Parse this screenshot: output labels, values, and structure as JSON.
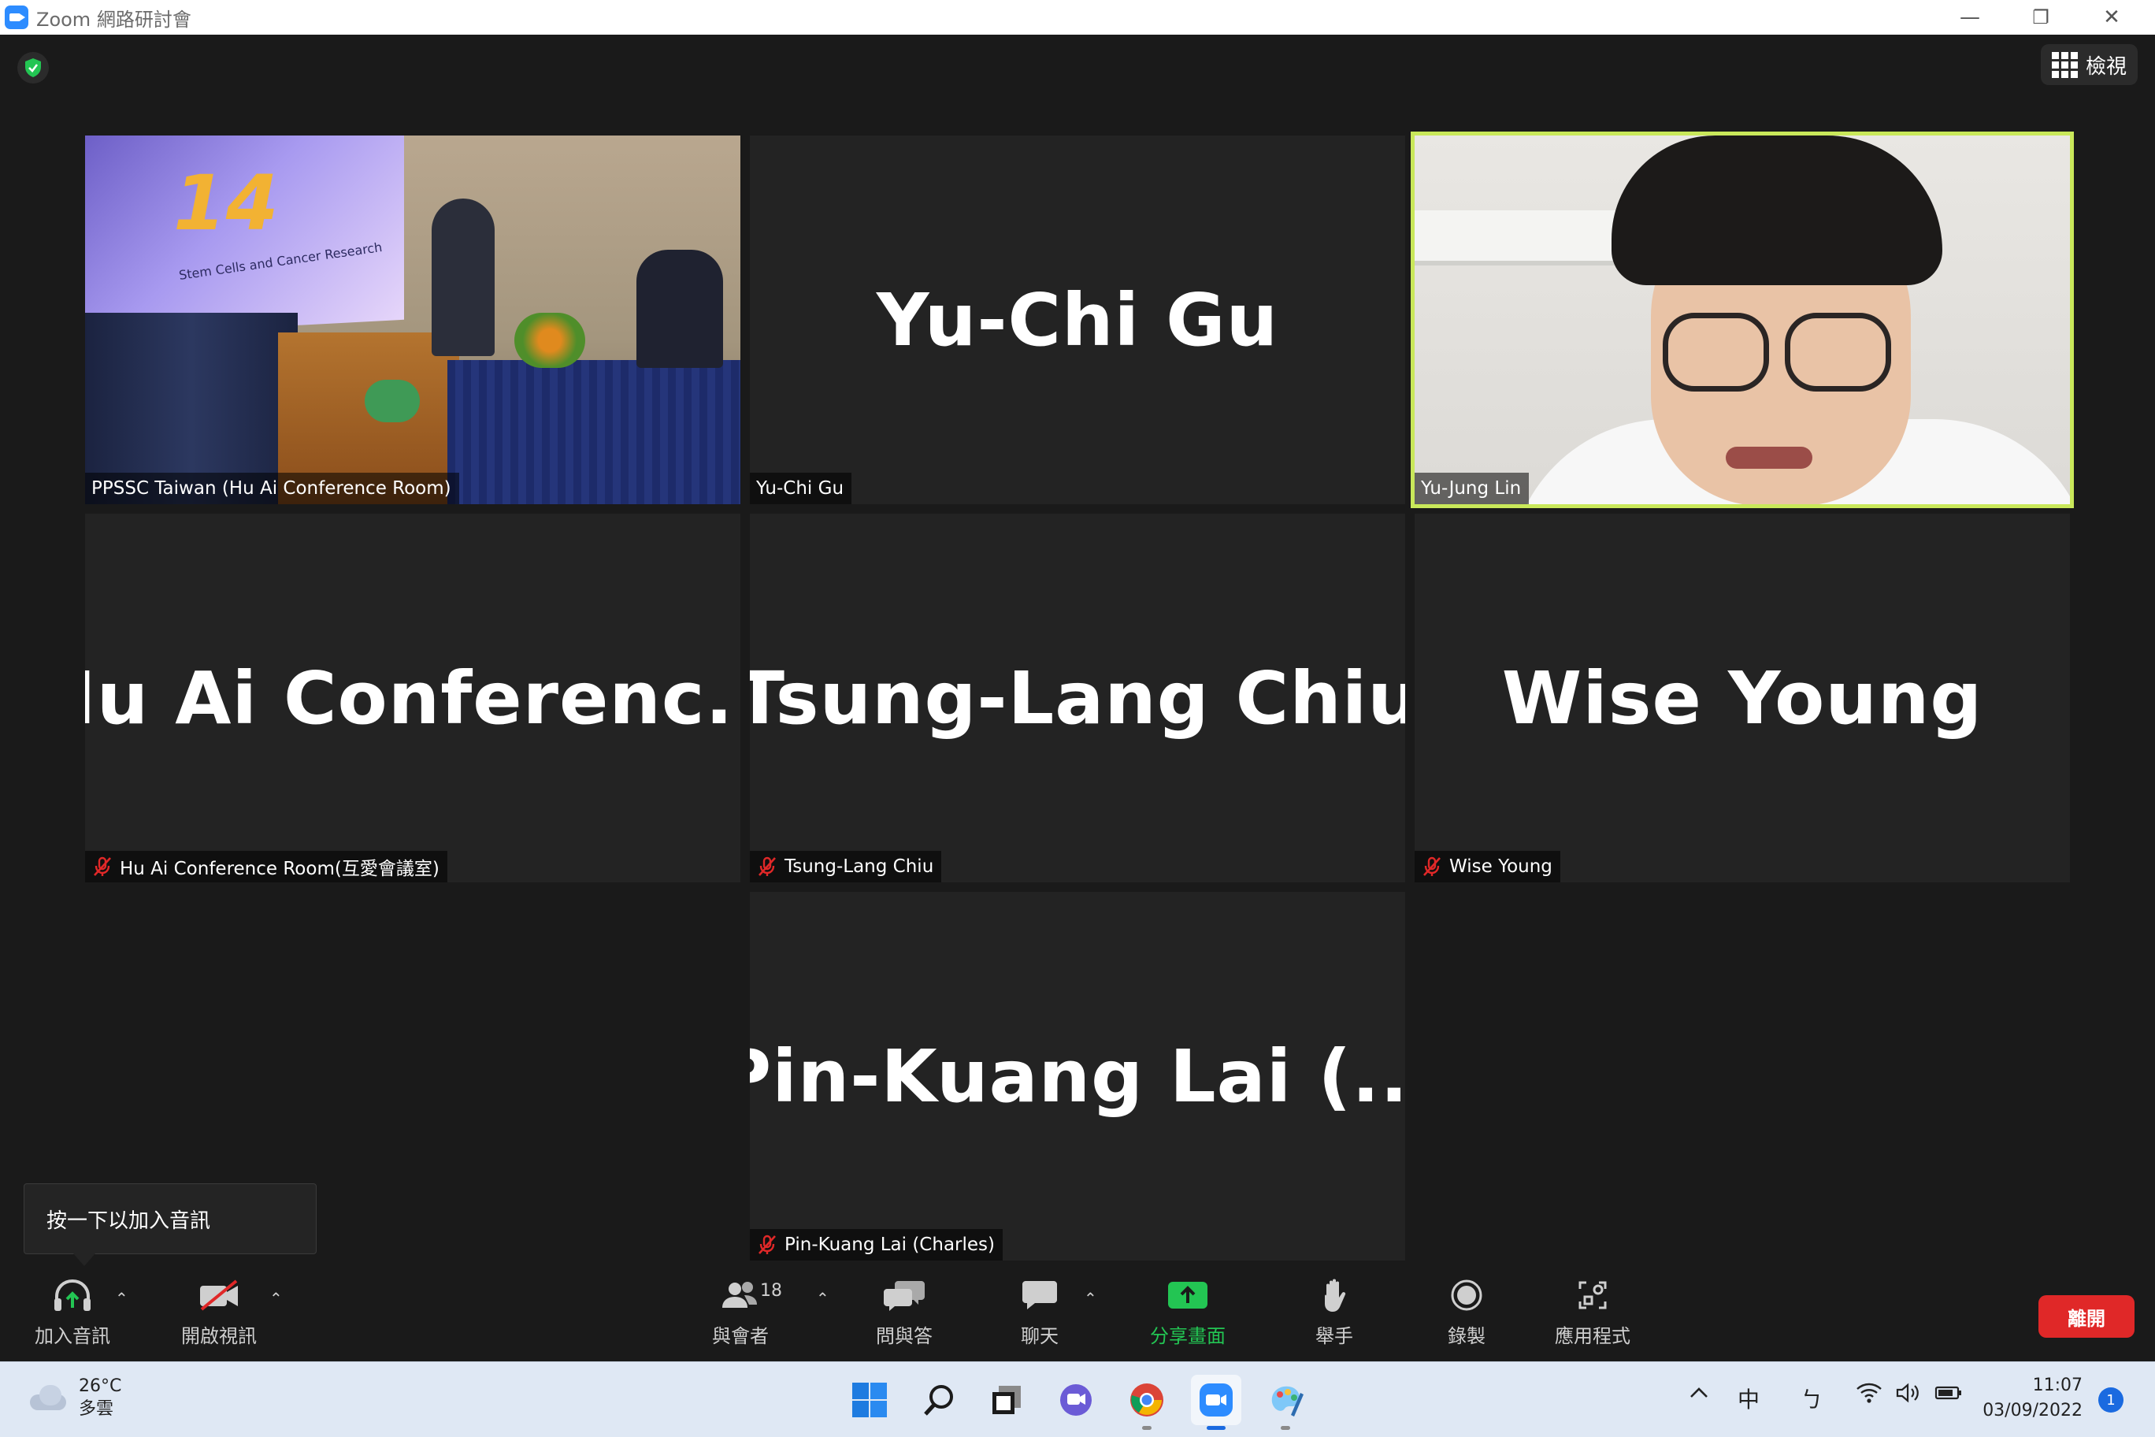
{
  "window": {
    "title": "Zoom 網路研討會",
    "minimize_glyph": "—",
    "restore_glyph": "❐",
    "close_glyph": "✕"
  },
  "header": {
    "view_label": "檢視",
    "security_color": "#23c553"
  },
  "tiles": [
    {
      "label": "PPSSC Taiwan (Hu Ai Conference Room)",
      "type": "video",
      "muted": false
    },
    {
      "label": "Yu-Chi Gu",
      "display_name": "Yu-Chi Gu",
      "type": "name",
      "muted": false
    },
    {
      "label": "Yu-Jung Lin",
      "type": "video",
      "muted": false,
      "active_speaker": true
    },
    {
      "label": "Hu Ai Conference Room(互愛會議室)",
      "display_name": "Hu Ai Conferenc...",
      "type": "name",
      "muted": true
    },
    {
      "label": "Tsung-Lang Chiu",
      "display_name": "Tsung-Lang Chiu",
      "type": "name",
      "muted": true
    },
    {
      "label": "Wise Young",
      "display_name": "Wise Young",
      "type": "name",
      "muted": true
    },
    {
      "label": "Pin-Kuang Lai (Charles)",
      "display_name": "Pin-Kuang Lai (...",
      "type": "name",
      "muted": true
    }
  ],
  "slide": {
    "number": "14",
    "subtitle": "Stem Cells and Cancer Research"
  },
  "tooltip": {
    "text": "按一下以加入音訊"
  },
  "toolbar": {
    "join_audio": "加入音訊",
    "start_video": "開啟視訊",
    "participants": "與會者",
    "participants_count": "18",
    "qa": "問與答",
    "chat": "聊天",
    "share_screen": "分享畫面",
    "raise_hand": "舉手",
    "record": "錄製",
    "apps": "應用程式",
    "leave": "離開",
    "caret": "⌃",
    "share_color": "#23c553",
    "leave_color": "#e02828"
  },
  "taskbar": {
    "weather_temp": "26°C",
    "weather_desc": "多雲",
    "ime": "中",
    "ime2": "ㄅ",
    "time": "11:07",
    "date": "03/09/2022",
    "notification_count": "1",
    "apps": [
      "windows-start",
      "search",
      "task-view",
      "teams-chat",
      "chrome",
      "zoom",
      "paint"
    ]
  }
}
